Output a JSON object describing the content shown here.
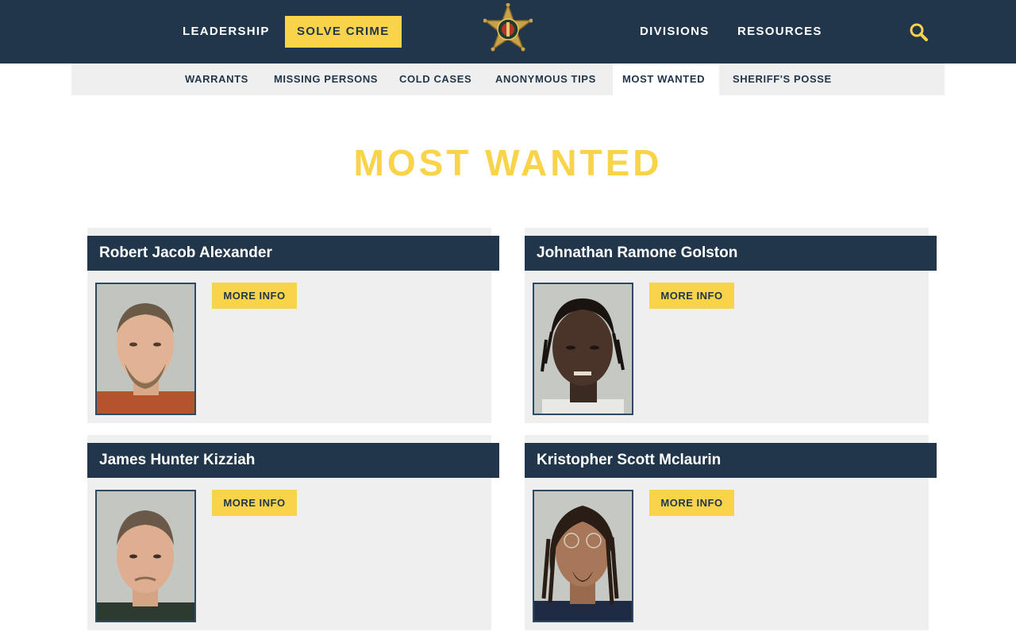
{
  "header": {
    "nav": [
      {
        "label": "LEADERSHIP"
      },
      {
        "label": "SOLVE CRIME",
        "active": true
      },
      {
        "label": "DIVISIONS"
      },
      {
        "label": "RESOURCES"
      }
    ],
    "logo_icon": "sheriff-star-badge-icon",
    "search_icon": "search-icon"
  },
  "subnav": {
    "items": [
      {
        "label": "WARRANTS"
      },
      {
        "label": "MISSING PERSONS"
      },
      {
        "label": "COLD CASES"
      },
      {
        "label": "ANONYMOUS TIPS"
      },
      {
        "label": "MOST WANTED",
        "active": true
      },
      {
        "label": "SHERIFF'S POSSE"
      }
    ]
  },
  "page": {
    "title": "MOST WANTED"
  },
  "wanted": [
    {
      "name": "Robert Jacob Alexander",
      "button": "MORE INFO"
    },
    {
      "name": "Johnathan Ramone Golston",
      "button": "MORE INFO"
    },
    {
      "name": "James Hunter Kizziah",
      "button": "MORE INFO"
    },
    {
      "name": "Kristopher Scott Mclaurin",
      "button": "MORE INFO"
    }
  ],
  "colors": {
    "navy": "#21364a",
    "gold": "#f9d34a",
    "panel": "#efefef"
  }
}
